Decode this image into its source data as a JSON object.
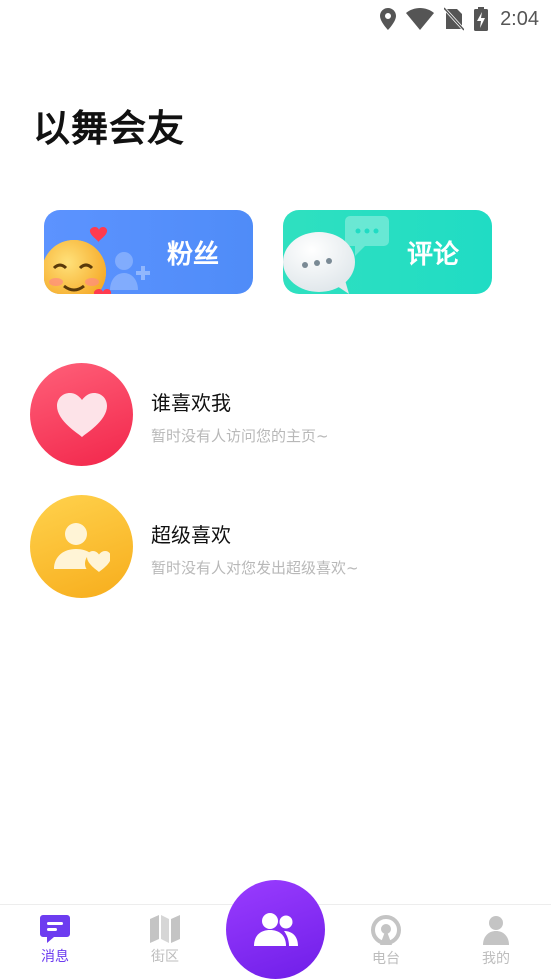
{
  "status_bar": {
    "time": "2:04",
    "icons": [
      "location-icon",
      "wifi-icon",
      "no-sim-icon",
      "battery-charging-icon"
    ]
  },
  "page": {
    "title": "以舞会友"
  },
  "cards": {
    "fans": {
      "label": "粉丝",
      "color": "#5c93ff"
    },
    "comments": {
      "label": "评论",
      "color": "#2fe0c0"
    }
  },
  "list": [
    {
      "title": "谁喜欢我",
      "subtitle": "暂时没有人访问您的主页~",
      "icon": "heart-icon",
      "color": "#f2264b"
    },
    {
      "title": "超级喜欢",
      "subtitle": "暂时没有人对您发出超级喜欢~",
      "icon": "user-heart-icon",
      "color": "#f7ad1c"
    }
  ],
  "tab_bar": {
    "tabs": [
      {
        "label": "消息",
        "icon": "message-icon",
        "active": true
      },
      {
        "label": "街区",
        "icon": "map-icon",
        "active": false
      },
      {
        "label": "",
        "icon": "users-icon",
        "center": true
      },
      {
        "label": "电台",
        "icon": "radio-icon",
        "active": false
      },
      {
        "label": "我的",
        "icon": "person-icon",
        "active": false
      }
    ],
    "active_color": "#6d3cf0",
    "inactive_color": "#bdbdbd"
  }
}
